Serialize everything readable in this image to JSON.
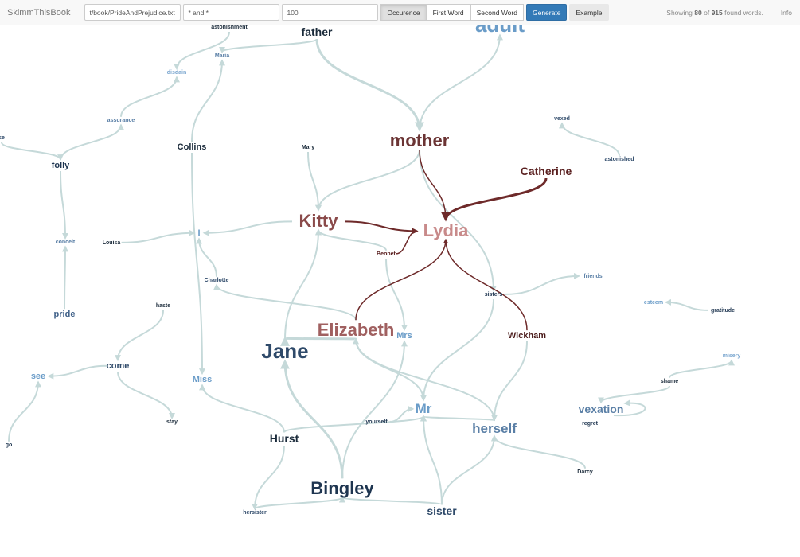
{
  "navbar": {
    "brand": "SkimmThisBook",
    "file_input": "t/book/PrideAndPrejudice.txt",
    "pattern_input": "* and *",
    "count_input": "100",
    "sort_buttons": [
      {
        "label": "Occurence",
        "active": true
      },
      {
        "label": "First Word",
        "active": false
      },
      {
        "label": "Second Word",
        "active": false
      }
    ],
    "generate_label": "Generate",
    "example_label": "Example",
    "status": {
      "prefix": "Showing",
      "shown": "80",
      "of": "of",
      "total": "915",
      "suffix": "found words."
    },
    "info_label": "Info"
  },
  "colors": {
    "edge": "#c5d9d9",
    "edge_highlight": "#6e2a2a",
    "accent": "#337ab7"
  },
  "graph": {
    "nodes": [
      {
        "id": "adult",
        "text": "adult",
        "color": "#6a9cc8",
        "weight": 6
      },
      {
        "id": "father",
        "text": "father",
        "color": "#1a2a3a",
        "weight": 3
      },
      {
        "id": "astonishment",
        "text": "astonishment",
        "color": "#1a2a3a",
        "weight": 1
      },
      {
        "id": "Maria",
        "text": "Maria",
        "color": "#5a7fa6",
        "weight": 1
      },
      {
        "id": "disdain",
        "text": "disdain",
        "color": "#7aa6cf",
        "weight": 1
      },
      {
        "id": "assurance",
        "text": "assurance",
        "color": "#5a7fa6",
        "weight": 1
      },
      {
        "id": "Collins",
        "text": "Collins",
        "color": "#1a2a3a",
        "weight": 2
      },
      {
        "id": "se",
        "text": "se",
        "color": "#2f4a6a",
        "weight": 1
      },
      {
        "id": "folly",
        "text": "folly",
        "color": "#1e3550",
        "weight": 2
      },
      {
        "id": "mother",
        "text": "mother",
        "color": "#6b3434",
        "weight": 5
      },
      {
        "id": "Mary",
        "text": "Mary",
        "color": "#1a2a3a",
        "weight": 1
      },
      {
        "id": "vexed",
        "text": "vexed",
        "color": "#2f4a6a",
        "weight": 1
      },
      {
        "id": "astonished",
        "text": "astonished",
        "color": "#2f4a6a",
        "weight": 1
      },
      {
        "id": "Catherine",
        "text": "Catherine",
        "color": "#5a2020",
        "weight": 3
      },
      {
        "id": "Kitty",
        "text": "Kitty",
        "color": "#8a4a4a",
        "weight": 5
      },
      {
        "id": "Lydia",
        "text": "Lydia",
        "color": "#c88a8a",
        "weight": 5
      },
      {
        "id": "Bennet",
        "text": "Bennet",
        "color": "#5a2020",
        "weight": 1
      },
      {
        "id": "I",
        "text": "I",
        "color": "#6a9cc8",
        "weight": 2
      },
      {
        "id": "Louisa",
        "text": "Louisa",
        "color": "#1a2a3a",
        "weight": 1
      },
      {
        "id": "conceit",
        "text": "conceit",
        "color": "#5a7fa6",
        "weight": 1
      },
      {
        "id": "Charlotte",
        "text": "Charlotte",
        "color": "#2f4a6a",
        "weight": 1
      },
      {
        "id": "friends",
        "text": "friends",
        "color": "#5a7fa6",
        "weight": 1
      },
      {
        "id": "sisters",
        "text": "sisters",
        "color": "#1e3550",
        "weight": 1
      },
      {
        "id": "esteem",
        "text": "esteem",
        "color": "#6a9cc8",
        "weight": 1
      },
      {
        "id": "gratitude",
        "text": "gratitude",
        "color": "#1e3550",
        "weight": 1
      },
      {
        "id": "pride",
        "text": "pride",
        "color": "#3f6088",
        "weight": 2
      },
      {
        "id": "haste",
        "text": "haste",
        "color": "#1a2a3a",
        "weight": 1
      },
      {
        "id": "Elizabeth",
        "text": "Elizabeth",
        "color": "#a06060",
        "weight": 5
      },
      {
        "id": "Mrs",
        "text": "Mrs",
        "color": "#6a9cc8",
        "weight": 2
      },
      {
        "id": "Wickham",
        "text": "Wickham",
        "color": "#4a1a1a",
        "weight": 2
      },
      {
        "id": "Jane",
        "text": "Jane",
        "color": "#2f4a6a",
        "weight": 6
      },
      {
        "id": "come",
        "text": "come",
        "color": "#2f4a6a",
        "weight": 2
      },
      {
        "id": "see",
        "text": "see",
        "color": "#6a9cc8",
        "weight": 2
      },
      {
        "id": "Miss",
        "text": "Miss",
        "color": "#6a9cc8",
        "weight": 2
      },
      {
        "id": "misery",
        "text": "misery",
        "color": "#7aa6cf",
        "weight": 1
      },
      {
        "id": "shame",
        "text": "shame",
        "color": "#1a2a3a",
        "weight": 1
      },
      {
        "id": "vexation",
        "text": "vexation",
        "color": "#5a7fa6",
        "weight": 3
      },
      {
        "id": "regret",
        "text": "regret",
        "color": "#1e3550",
        "weight": 1
      },
      {
        "id": "Mr",
        "text": "Mr",
        "color": "#6a9cc8",
        "weight": 4
      },
      {
        "id": "yourself",
        "text": "yourself",
        "color": "#1e3550",
        "weight": 1
      },
      {
        "id": "herself",
        "text": "herself",
        "color": "#5a7fa6",
        "weight": 4
      },
      {
        "id": "stay",
        "text": "stay",
        "color": "#1a2a3a",
        "weight": 1
      },
      {
        "id": "go",
        "text": "go",
        "color": "#1e3550",
        "weight": 1
      },
      {
        "id": "Hurst",
        "text": "Hurst",
        "color": "#1a2a3a",
        "weight": 3
      },
      {
        "id": "Darcy",
        "text": "Darcy",
        "color": "#1a2a3a",
        "weight": 1
      },
      {
        "id": "Bingley",
        "text": "Bingley",
        "color": "#1e3550",
        "weight": 5
      },
      {
        "id": "hersister",
        "text": "hersister",
        "color": "#2f4a6a",
        "weight": 1
      },
      {
        "id": "sister",
        "text": "sister",
        "color": "#2f4a6a",
        "weight": 3
      }
    ],
    "edges": [
      [
        "father",
        "Maria",
        0
      ],
      [
        "father",
        "mother",
        0,
        3
      ],
      [
        "astonishment",
        "disdain",
        0
      ],
      [
        "assurance",
        "disdain",
        0
      ],
      [
        "folly",
        "assurance",
        0
      ],
      [
        "se",
        "folly",
        0
      ],
      [
        "folly",
        "conceit",
        0
      ],
      [
        "pride",
        "conceit",
        0
      ],
      [
        "Collins",
        "Maria",
        0
      ],
      [
        "Collins",
        "Miss",
        0
      ],
      [
        "mother",
        "adult",
        0
      ],
      [
        "mother",
        "Kitty",
        0
      ],
      [
        "mother",
        "sisters",
        0
      ],
      [
        "Mary",
        "Kitty",
        0,
        2
      ],
      [
        "Kitty",
        "I",
        0
      ],
      [
        "Louisa",
        "I",
        0
      ],
      [
        "Charlotte",
        "I",
        0
      ],
      [
        "Bennet",
        "Kitty",
        0
      ],
      [
        "Elizabeth",
        "Charlotte",
        0
      ],
      [
        "Jane",
        "Kitty",
        0
      ],
      [
        "Elizabeth",
        "Jane",
        0,
        3
      ],
      [
        "Elizabeth",
        "Mr",
        0
      ],
      [
        "Bennet",
        "Mrs",
        0
      ],
      [
        "sisters",
        "friends",
        0
      ],
      [
        "gratitude",
        "esteem",
        0
      ],
      [
        "astonished",
        "vexed",
        0
      ],
      [
        "haste",
        "come",
        0
      ],
      [
        "come",
        "see",
        0
      ],
      [
        "come",
        "stay",
        0
      ],
      [
        "go",
        "see",
        0
      ],
      [
        "Hurst",
        "Miss",
        0,
        2
      ],
      [
        "Hurst",
        "Mr",
        0
      ],
      [
        "Hurst",
        "hersister",
        0
      ],
      [
        "hersister",
        "Bingley",
        0
      ],
      [
        "Bingley",
        "Jane",
        0,
        3
      ],
      [
        "yourself",
        "Mr",
        0
      ],
      [
        "Bingley",
        "Mrs",
        0
      ],
      [
        "sister",
        "Bingley",
        0
      ],
      [
        "sister",
        "Mr",
        0
      ],
      [
        "sister",
        "herself",
        0
      ],
      [
        "herself",
        "Mr",
        0
      ],
      [
        "Darcy",
        "herself",
        0
      ],
      [
        "Wickham",
        "herself",
        0
      ],
      [
        "herself",
        "Elizabeth",
        0
      ],
      [
        "shame",
        "vexation",
        0
      ],
      [
        "shame",
        "misery",
        0
      ],
      [
        "regret",
        "vexation",
        0
      ],
      [
        "sisters",
        "Mr",
        0
      ],
      [
        "mother",
        "Lydia",
        1
      ],
      [
        "Catherine",
        "Lydia",
        1,
        3
      ],
      [
        "Kitty",
        "Lydia",
        1,
        2
      ],
      [
        "Bennet",
        "Lydia",
        1
      ],
      [
        "Elizabeth",
        "Lydia",
        1
      ],
      [
        "Wickham",
        "Lydia",
        1
      ]
    ]
  }
}
